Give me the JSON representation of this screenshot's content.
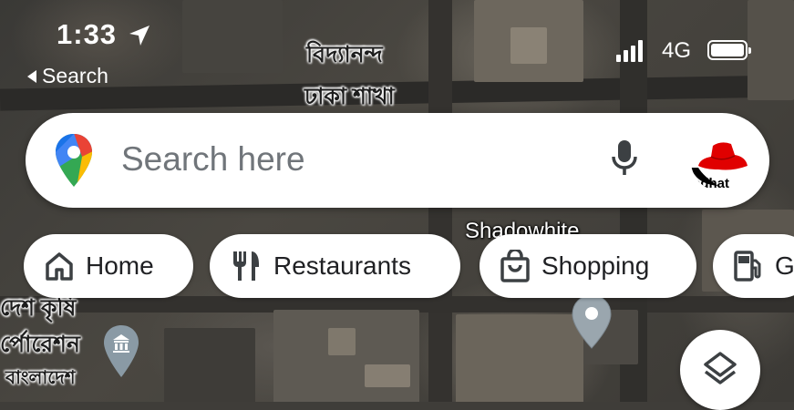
{
  "status_bar": {
    "time": "1:33",
    "back_label": "Search",
    "network": "4G"
  },
  "map_labels": {
    "top_line1": "বিদ্যানন্দ",
    "top_line2": "ঢাকা শাখা",
    "shadowhite": "Shadowhite",
    "left_line1": "দেশ কৃষি",
    "left_line2": "র্পোরেশন",
    "left_line3": "বাংলাদেশ"
  },
  "search": {
    "placeholder": "Search here"
  },
  "chips": [
    {
      "label": "Home",
      "icon": "home-icon"
    },
    {
      "label": "Restaurants",
      "icon": "fork-knife-icon"
    },
    {
      "label": "Shopping",
      "icon": "shopping-bag-icon"
    },
    {
      "label": "G",
      "icon": "gas-station-icon"
    }
  ],
  "colors": {
    "maps_red": "#EA4335",
    "maps_blue": "#4285F4",
    "maps_green": "#34A853",
    "maps_yellow": "#FBBC04",
    "poi_gray": "#8a9aa5",
    "avatar_red": "#e00000"
  },
  "icons": {
    "location_arrow": "location-arrow-icon",
    "signal": "signal-bars-icon",
    "battery": "battery-icon",
    "maps_pin": "google-maps-pin-icon",
    "mic": "microphone-icon",
    "avatar": "redhat-avatar",
    "poi_institution": "institution-pin-icon",
    "poi_gray": "place-pin-icon",
    "layers": "layers-icon"
  }
}
